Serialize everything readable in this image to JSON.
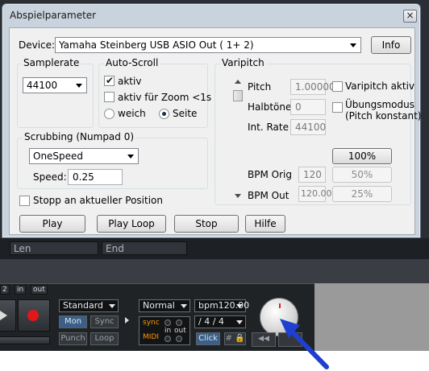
{
  "dialog": {
    "title": "Abspielparameter",
    "close_glyph": "×",
    "device_label": "Device:",
    "device_value": "Yamaha Steinberg USB ASIO Out ( 1+ 2)",
    "info_button": "Info"
  },
  "samplerate": {
    "title": "Samplerate",
    "value": "44100"
  },
  "autoscroll": {
    "title": "Auto-Scroll",
    "aktiv_label": "aktiv",
    "aktiv_checked": true,
    "zoom_label": "aktiv für Zoom <1s",
    "zoom_checked": false,
    "radio_weich": "weich",
    "radio_seite": "Seite",
    "selected": "Seite"
  },
  "scrubbing": {
    "title": "Scrubbing  (Numpad 0)",
    "mode_value": "OneSpeed",
    "speed_label": "Speed:",
    "speed_value": "0.25"
  },
  "stopp": {
    "label": "Stopp an aktueller Position",
    "checked": false
  },
  "varipitch": {
    "title": "Varipitch",
    "pitch_label": "Pitch",
    "pitch_value": "1.00000",
    "halbtoene_label": "Halbtöne",
    "halbtoene_value": "0",
    "intrate_label": "Int. Rate",
    "intrate_value": "44100",
    "varipitch_aktiv_label": "Varipitch aktiv",
    "uebungsmodus_label_1": "Übungsmodus",
    "uebungsmodus_label_2": "(Pitch konstant)",
    "percent_button": "100%",
    "bpm_orig_label": "BPM Orig",
    "bpm_orig_value": "120",
    "bpm_orig_pct": "50%",
    "bpm_out_label": "BPM Out",
    "bpm_out_value": "120.00",
    "bpm_out_pct": "25%"
  },
  "buttons": {
    "play": "Play",
    "play_loop": "Play Loop",
    "stop": "Stop",
    "hilfe": "Hilfe"
  },
  "host": {
    "len_label": "Len",
    "end_label": "End",
    "tab_2": "2",
    "tab_in": "in",
    "tab_out": "out",
    "mode_combo": "Standard",
    "normal_combo": "Normal",
    "bpm_combo": "bpm120.00",
    "meter_combo": "/ 4 / 4",
    "mon": "Mon",
    "sync": "Sync",
    "punch": "Punch",
    "loop": "Loop",
    "sync_lbl": "sync",
    "midi_lbl": "MIDI",
    "in_lbl": "in",
    "out_lbl": "out",
    "click": "Click",
    "hash_lock": "# 🔒",
    "rew": "◀◀"
  },
  "colors": {
    "arrow": "#1e3fd0",
    "accent_blue": "#3b5f86",
    "record_red": "#e01818"
  }
}
